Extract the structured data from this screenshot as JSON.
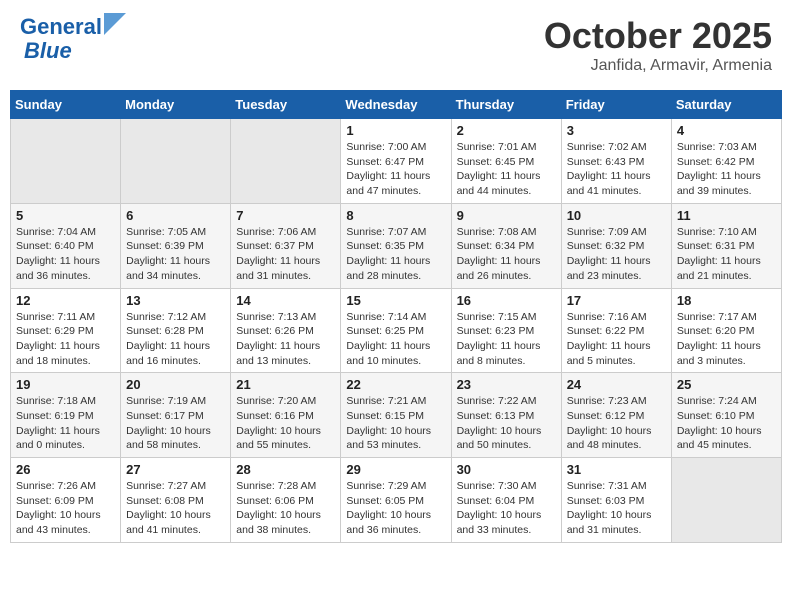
{
  "header": {
    "logo_line1": "General",
    "logo_line2": "Blue",
    "month": "October 2025",
    "location": "Janfida, Armavir, Armenia"
  },
  "days_of_week": [
    "Sunday",
    "Monday",
    "Tuesday",
    "Wednesday",
    "Thursday",
    "Friday",
    "Saturday"
  ],
  "weeks": [
    [
      {
        "day": "",
        "info": ""
      },
      {
        "day": "",
        "info": ""
      },
      {
        "day": "",
        "info": ""
      },
      {
        "day": "1",
        "info": "Sunrise: 7:00 AM\nSunset: 6:47 PM\nDaylight: 11 hours\nand 47 minutes."
      },
      {
        "day": "2",
        "info": "Sunrise: 7:01 AM\nSunset: 6:45 PM\nDaylight: 11 hours\nand 44 minutes."
      },
      {
        "day": "3",
        "info": "Sunrise: 7:02 AM\nSunset: 6:43 PM\nDaylight: 11 hours\nand 41 minutes."
      },
      {
        "day": "4",
        "info": "Sunrise: 7:03 AM\nSunset: 6:42 PM\nDaylight: 11 hours\nand 39 minutes."
      }
    ],
    [
      {
        "day": "5",
        "info": "Sunrise: 7:04 AM\nSunset: 6:40 PM\nDaylight: 11 hours\nand 36 minutes."
      },
      {
        "day": "6",
        "info": "Sunrise: 7:05 AM\nSunset: 6:39 PM\nDaylight: 11 hours\nand 34 minutes."
      },
      {
        "day": "7",
        "info": "Sunrise: 7:06 AM\nSunset: 6:37 PM\nDaylight: 11 hours\nand 31 minutes."
      },
      {
        "day": "8",
        "info": "Sunrise: 7:07 AM\nSunset: 6:35 PM\nDaylight: 11 hours\nand 28 minutes."
      },
      {
        "day": "9",
        "info": "Sunrise: 7:08 AM\nSunset: 6:34 PM\nDaylight: 11 hours\nand 26 minutes."
      },
      {
        "day": "10",
        "info": "Sunrise: 7:09 AM\nSunset: 6:32 PM\nDaylight: 11 hours\nand 23 minutes."
      },
      {
        "day": "11",
        "info": "Sunrise: 7:10 AM\nSunset: 6:31 PM\nDaylight: 11 hours\nand 21 minutes."
      }
    ],
    [
      {
        "day": "12",
        "info": "Sunrise: 7:11 AM\nSunset: 6:29 PM\nDaylight: 11 hours\nand 18 minutes."
      },
      {
        "day": "13",
        "info": "Sunrise: 7:12 AM\nSunset: 6:28 PM\nDaylight: 11 hours\nand 16 minutes."
      },
      {
        "day": "14",
        "info": "Sunrise: 7:13 AM\nSunset: 6:26 PM\nDaylight: 11 hours\nand 13 minutes."
      },
      {
        "day": "15",
        "info": "Sunrise: 7:14 AM\nSunset: 6:25 PM\nDaylight: 11 hours\nand 10 minutes."
      },
      {
        "day": "16",
        "info": "Sunrise: 7:15 AM\nSunset: 6:23 PM\nDaylight: 11 hours\nand 8 minutes."
      },
      {
        "day": "17",
        "info": "Sunrise: 7:16 AM\nSunset: 6:22 PM\nDaylight: 11 hours\nand 5 minutes."
      },
      {
        "day": "18",
        "info": "Sunrise: 7:17 AM\nSunset: 6:20 PM\nDaylight: 11 hours\nand 3 minutes."
      }
    ],
    [
      {
        "day": "19",
        "info": "Sunrise: 7:18 AM\nSunset: 6:19 PM\nDaylight: 11 hours\nand 0 minutes."
      },
      {
        "day": "20",
        "info": "Sunrise: 7:19 AM\nSunset: 6:17 PM\nDaylight: 10 hours\nand 58 minutes."
      },
      {
        "day": "21",
        "info": "Sunrise: 7:20 AM\nSunset: 6:16 PM\nDaylight: 10 hours\nand 55 minutes."
      },
      {
        "day": "22",
        "info": "Sunrise: 7:21 AM\nSunset: 6:15 PM\nDaylight: 10 hours\nand 53 minutes."
      },
      {
        "day": "23",
        "info": "Sunrise: 7:22 AM\nSunset: 6:13 PM\nDaylight: 10 hours\nand 50 minutes."
      },
      {
        "day": "24",
        "info": "Sunrise: 7:23 AM\nSunset: 6:12 PM\nDaylight: 10 hours\nand 48 minutes."
      },
      {
        "day": "25",
        "info": "Sunrise: 7:24 AM\nSunset: 6:10 PM\nDaylight: 10 hours\nand 45 minutes."
      }
    ],
    [
      {
        "day": "26",
        "info": "Sunrise: 7:26 AM\nSunset: 6:09 PM\nDaylight: 10 hours\nand 43 minutes."
      },
      {
        "day": "27",
        "info": "Sunrise: 7:27 AM\nSunset: 6:08 PM\nDaylight: 10 hours\nand 41 minutes."
      },
      {
        "day": "28",
        "info": "Sunrise: 7:28 AM\nSunset: 6:06 PM\nDaylight: 10 hours\nand 38 minutes."
      },
      {
        "day": "29",
        "info": "Sunrise: 7:29 AM\nSunset: 6:05 PM\nDaylight: 10 hours\nand 36 minutes."
      },
      {
        "day": "30",
        "info": "Sunrise: 7:30 AM\nSunset: 6:04 PM\nDaylight: 10 hours\nand 33 minutes."
      },
      {
        "day": "31",
        "info": "Sunrise: 7:31 AM\nSunset: 6:03 PM\nDaylight: 10 hours\nand 31 minutes."
      },
      {
        "day": "",
        "info": ""
      }
    ]
  ]
}
